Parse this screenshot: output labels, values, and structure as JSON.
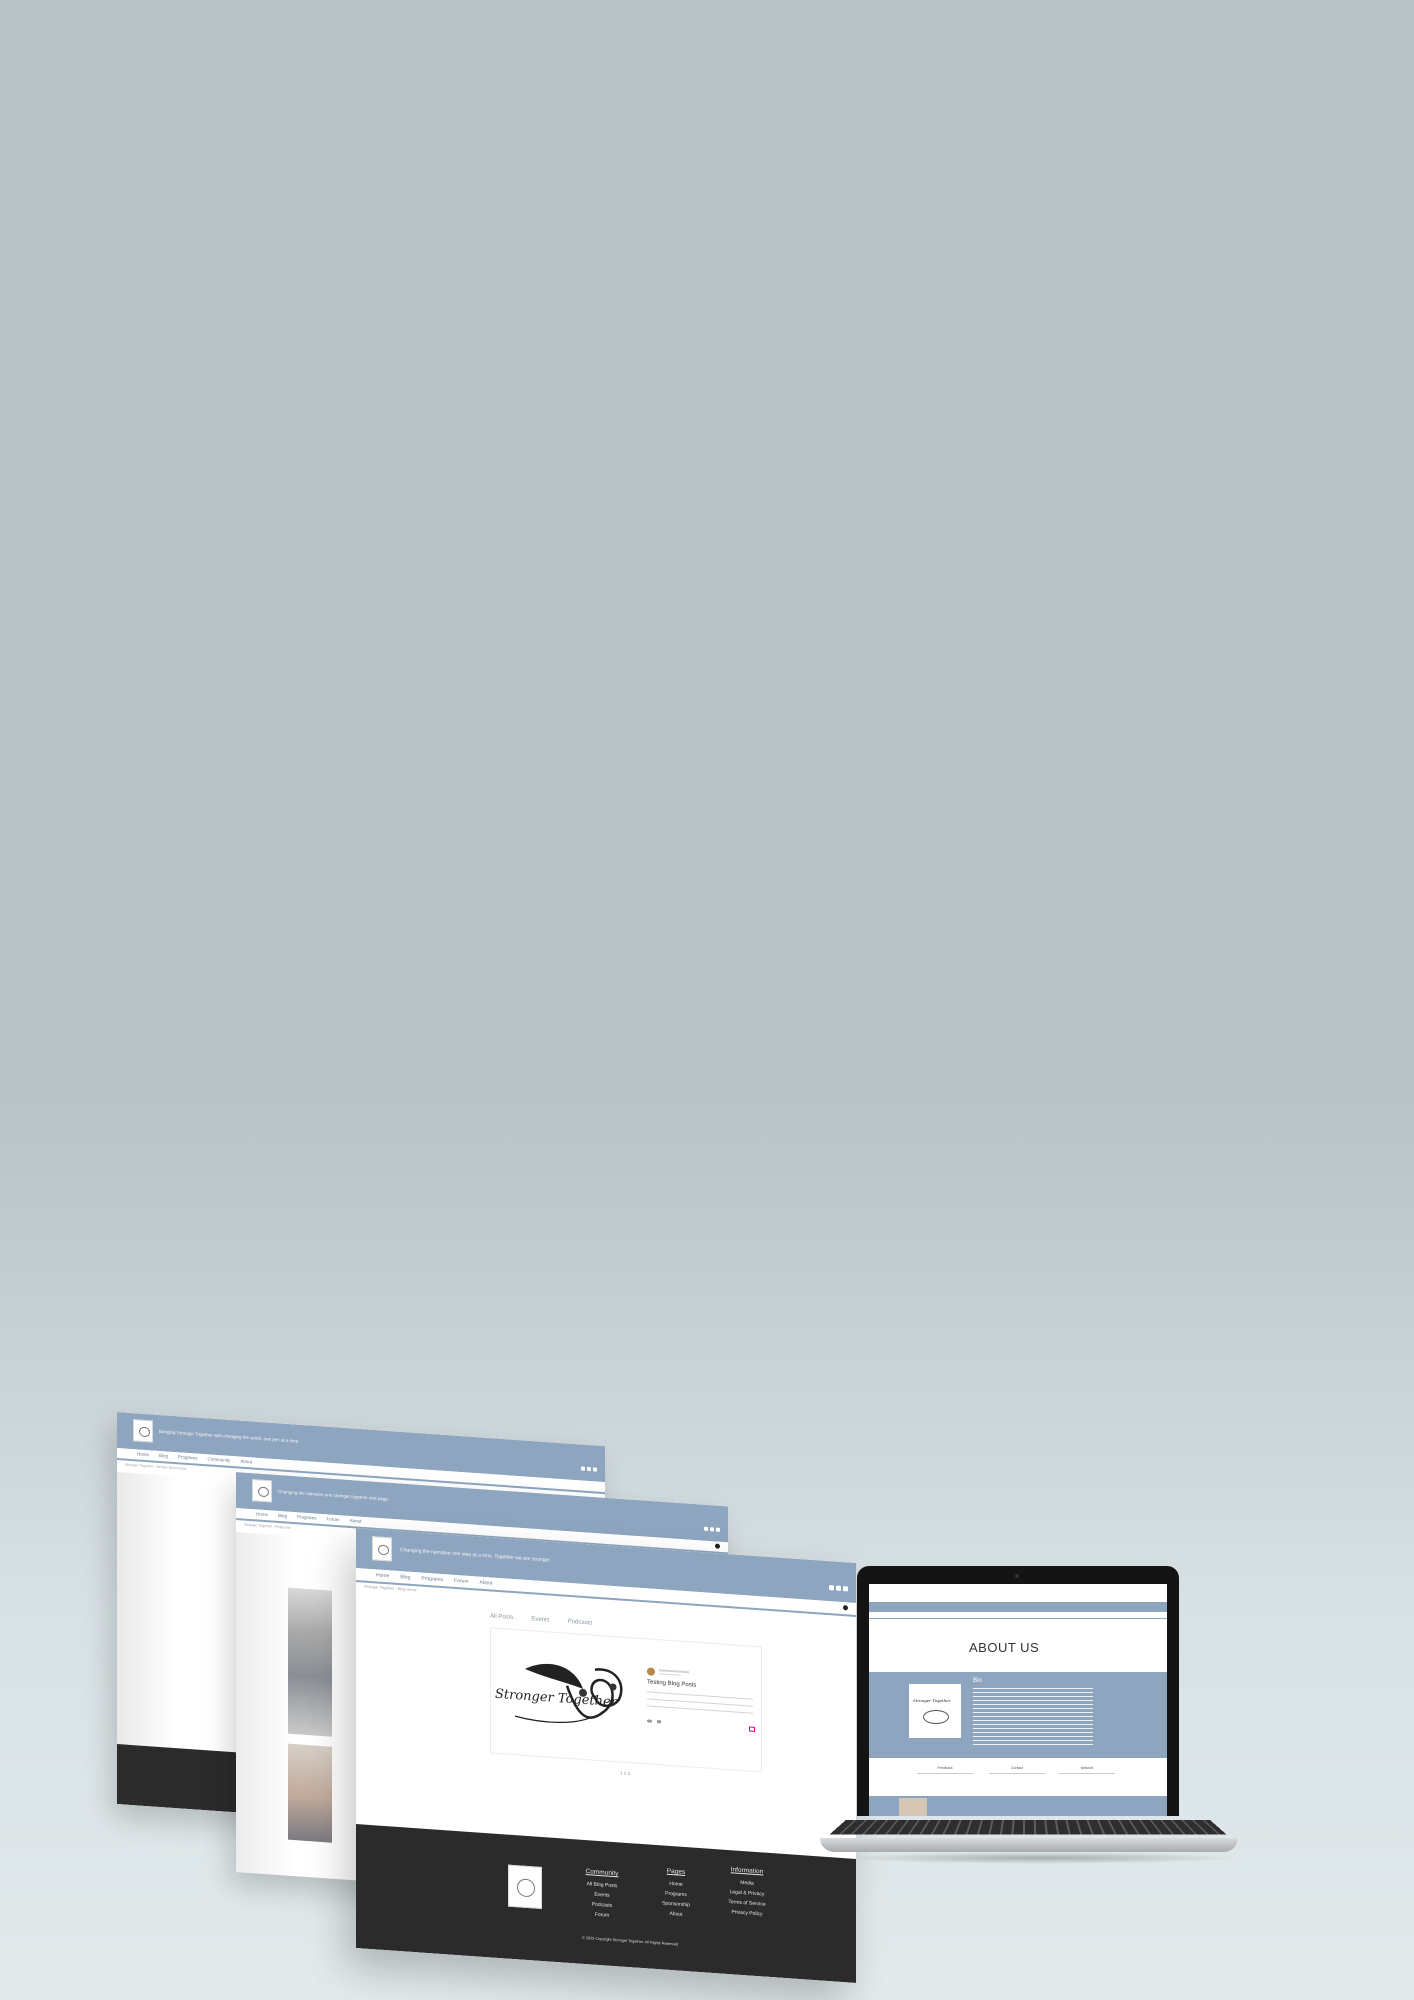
{
  "back_page": {
    "tagline": "Bringing Stronger Together with changing the world, one pen at a time.",
    "nav": [
      "Home",
      "Blog",
      "Programs",
      "Community",
      "About"
    ],
    "breadcrumb": "Stronger Together  ›  Gender Dominance"
  },
  "middle_page": {
    "tagline": "Changing the narrative one stronger together one page.",
    "nav": [
      "Home",
      "Blog",
      "Programs",
      "Forum",
      "About"
    ],
    "breadcrumb": "Stronger Together  ›  Programs"
  },
  "front_page": {
    "tagline": "Changing the narrative one step at a time. Together we are stronger.",
    "nav": [
      "Home",
      "Blog",
      "Programs",
      "Forum",
      "About"
    ],
    "breadcrumb": "Stronger Together  ›  Blog Home",
    "tabs": [
      "All Posts",
      "Events",
      "Podcasts"
    ],
    "post": {
      "logo_text": "Stronger Together",
      "title": "Testing Blog Posts"
    },
    "pagination": "1 2 3",
    "footer": {
      "columns": [
        {
          "heading": "Community",
          "links": [
            "All Blog Posts",
            "Events",
            "Podcasts",
            "Forum"
          ]
        },
        {
          "heading": "Pages",
          "links": [
            "Home",
            "Programs",
            "Sponsorship",
            "About"
          ]
        },
        {
          "heading": "Information",
          "links": [
            "Media",
            "Legal & Privacy",
            "Terms of Service",
            "Privacy Policy"
          ]
        }
      ],
      "copyright": "© 2023 Copyright Stronger Together. All Rights Reserved"
    }
  },
  "laptop": {
    "heading": "ABOUT US",
    "bio_heading": "Bio",
    "logo_text": "Stronger Together",
    "feature_labels": [
      "Feedback",
      "Contact",
      "Network"
    ]
  },
  "colors": {
    "accent": "#8ea5bf",
    "footer": "#2b2b2b",
    "background": "#b9c3c6"
  }
}
